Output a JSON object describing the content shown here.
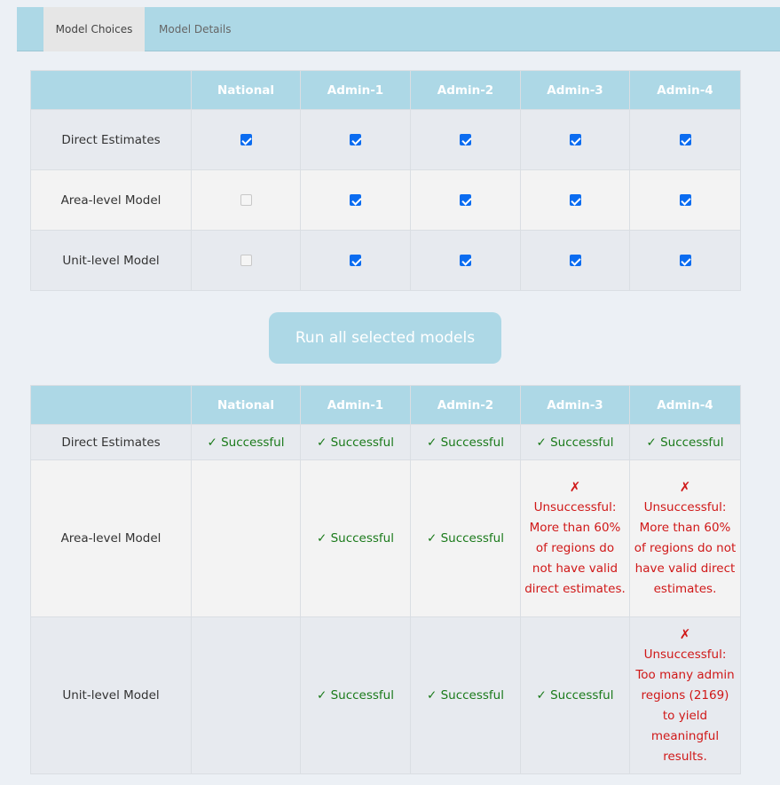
{
  "tabs": [
    {
      "label": "Model Choices",
      "active": true
    },
    {
      "label": "Model Details",
      "active": false
    }
  ],
  "columns": [
    "National",
    "Admin-1",
    "Admin-2",
    "Admin-3",
    "Admin-4"
  ],
  "choices": {
    "rows": [
      {
        "label": "Direct Estimates",
        "checked": [
          true,
          true,
          true,
          true,
          true
        ]
      },
      {
        "label": "Area-level Model",
        "checked": [
          false,
          true,
          true,
          true,
          true
        ]
      },
      {
        "label": "Unit-level Model",
        "checked": [
          false,
          true,
          true,
          true,
          true
        ]
      }
    ]
  },
  "run_button_label": "Run all selected models",
  "results": {
    "success_text": "✓ Successful",
    "fail_mark": "✗",
    "fail_area": "Unsuccessful: More than 60% of regions do not have valid direct estimates.",
    "fail_unit": "Unsuccessful: Too many admin regions (2169) to yield meaningful results.",
    "rows": [
      {
        "label": "Direct Estimates"
      },
      {
        "label": "Area-level Model"
      },
      {
        "label": "Unit-level Model"
      }
    ]
  },
  "colors": {
    "header_bg": "#add8e6",
    "success": "#1a7a1a",
    "failure": "#d01818",
    "checkbox": "#0b6cf0"
  }
}
